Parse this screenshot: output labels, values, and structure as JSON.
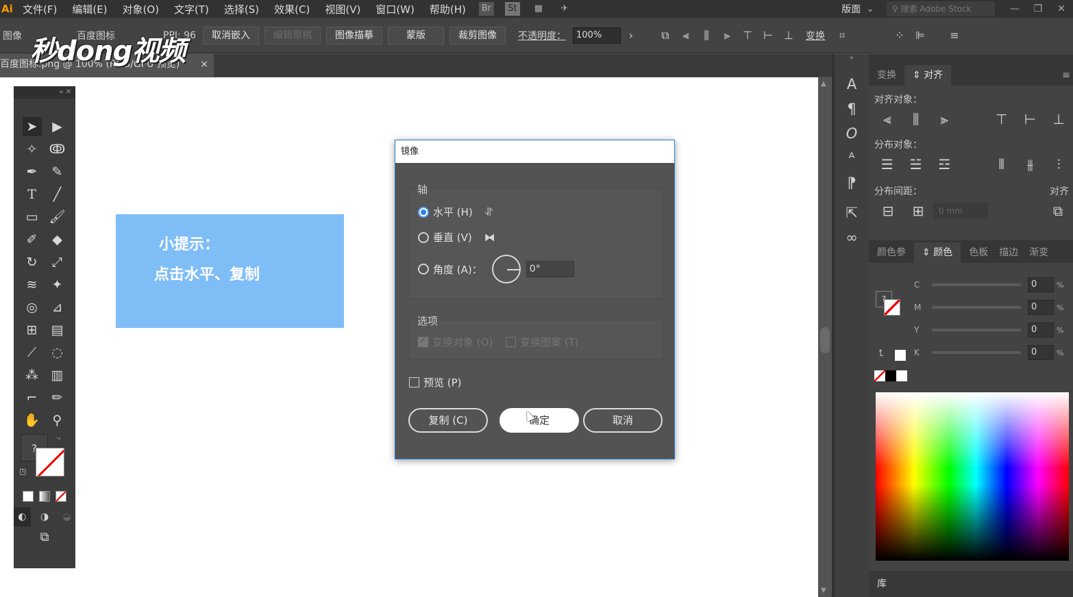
{
  "menu": {
    "logo": "Ai",
    "items": [
      "文件(F)",
      "编辑(E)",
      "对象(O)",
      "文字(T)",
      "选择(S)",
      "效果(C)",
      "视图(V)",
      "窗口(W)",
      "帮助(H)"
    ],
    "workspace": "版面",
    "stock_placeholder": "搜索 Adobe Stock"
  },
  "controlbar": {
    "label_image": "图像",
    "file_info": "百度图标",
    "ppi": "PPI: 96",
    "btn_unembed": "取消嵌入",
    "btn_edit_original": "编辑原稿",
    "btn_image_trace": "图像描摹",
    "btn_mask": "蒙版",
    "btn_crop": "裁剪图像",
    "opacity_label": "不透明度：",
    "opacity_value": "100%",
    "transform": "变换"
  },
  "doc_tab": {
    "title": "百度图标.png @ 100% (RGB/GPU 预览)",
    "close": "×"
  },
  "watermark": "秒dong视频",
  "tip": {
    "title": "小提示：",
    "body": "点击水平、复制"
  },
  "dialog": {
    "title": "镜像",
    "axis_group": "轴",
    "horizontal": "水平 (H)",
    "vertical": "垂直 (V)",
    "angle": "角度 (A)：",
    "angle_value": "0°",
    "options_group": "选项",
    "transform_objects": "变换对象 (O)",
    "transform_patterns": "变换图案 (T)",
    "preview": "预览 (P)",
    "btn_copy": "复制 (C)",
    "btn_ok": "确定",
    "btn_cancel": "取消",
    "selected_axis": "horizontal"
  },
  "align_panel": {
    "tabs": [
      "变换",
      "对齐"
    ],
    "active_tab": "对齐",
    "align_objects": "对齐对象：",
    "distribute_objects": "分布对象：",
    "distribute_spacing": "分布间距：",
    "align_to": "对齐",
    "spacing_value": "0 mm"
  },
  "color_panel": {
    "tabs": [
      "颜色参",
      "颜色",
      "色板",
      "描边",
      "渐变"
    ],
    "active_tab": "颜色",
    "c_label": "C",
    "m_label": "M",
    "y_label": "Y",
    "k_label": "K",
    "c": "0",
    "m": "0",
    "y": "0",
    "k": "0",
    "pct": "%"
  },
  "library": "库",
  "colors": {
    "tip_box": "#7fbdf7",
    "dialog_accent": "#2e7ad6",
    "radio_checked": "#2f80ed"
  }
}
